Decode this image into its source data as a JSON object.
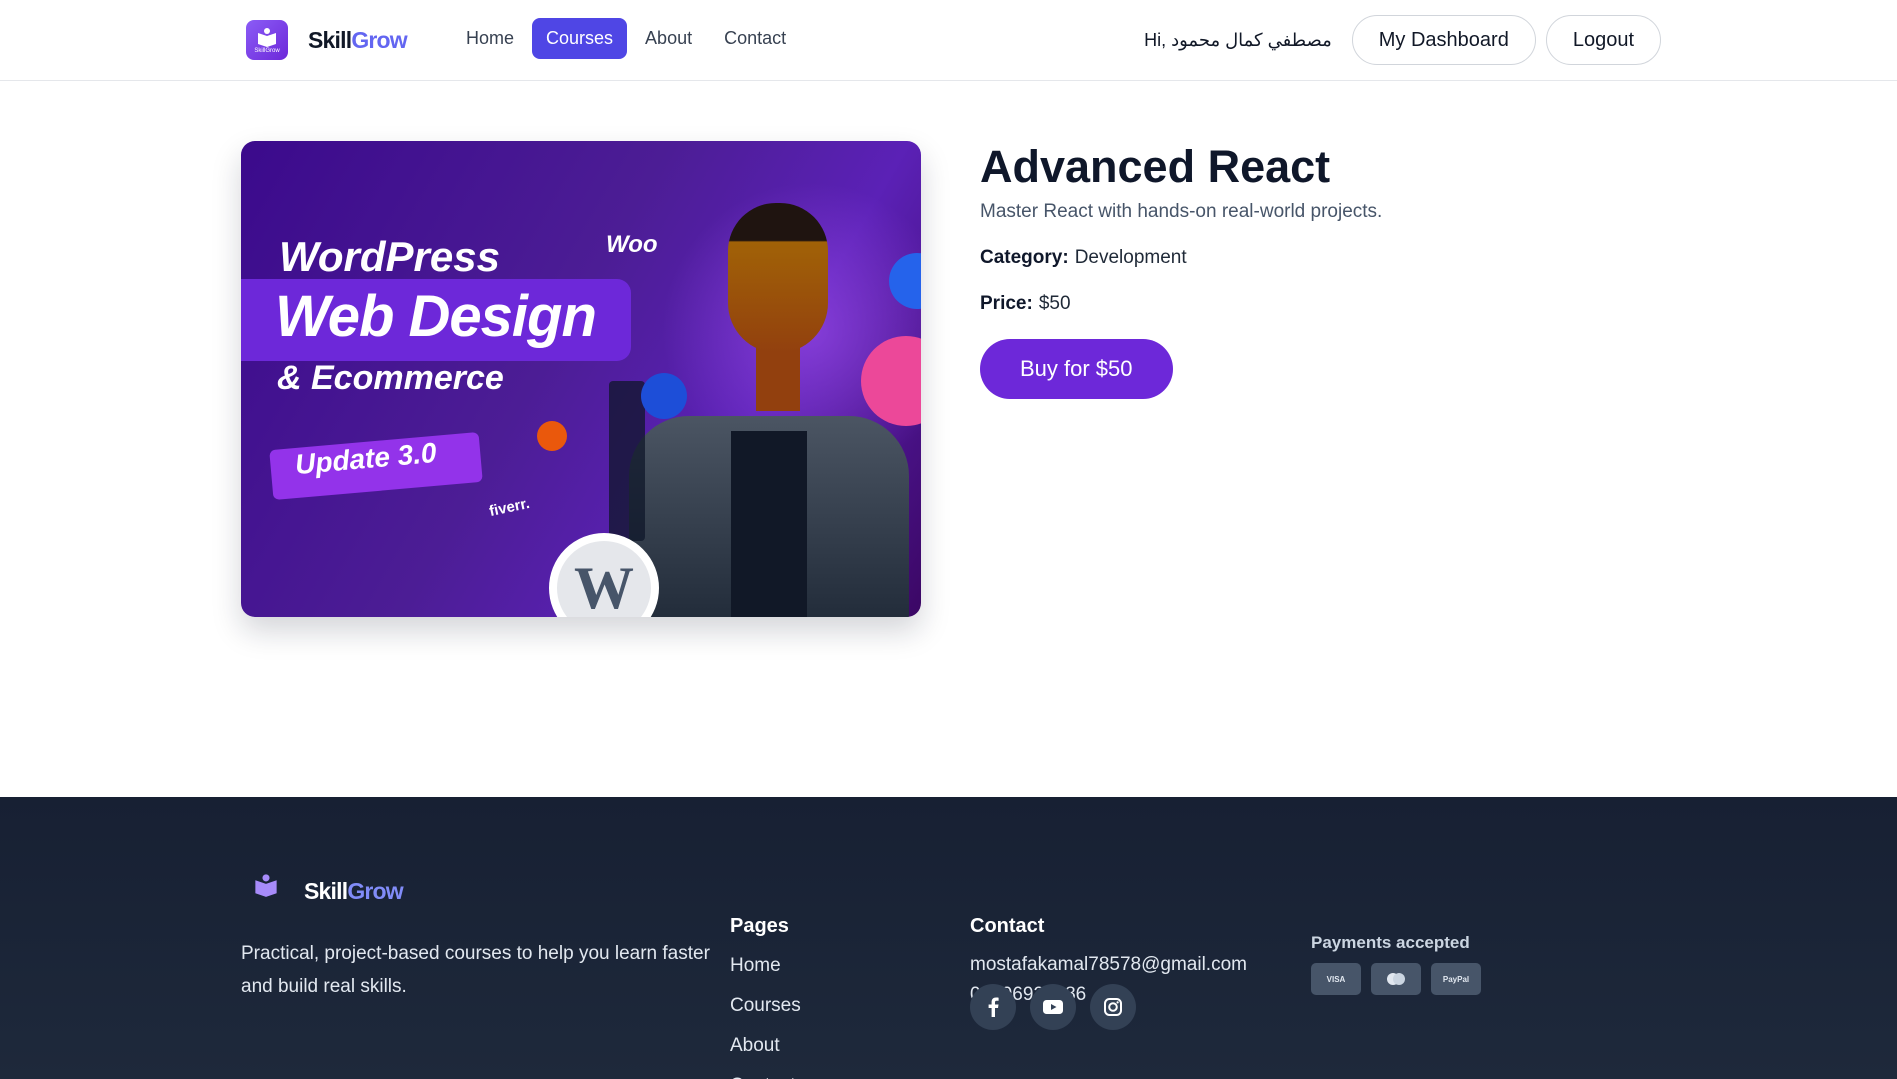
{
  "brand": {
    "name_part1": "Skill",
    "name_part2": "Grow",
    "badge_text": "SkillGrow"
  },
  "nav": {
    "items": [
      {
        "label": "Home",
        "active": false
      },
      {
        "label": "Courses",
        "active": true
      },
      {
        "label": "About",
        "active": false
      },
      {
        "label": "Contact",
        "active": false
      }
    ]
  },
  "user": {
    "greeting": "Hi, مصطفي كمال محمود",
    "dashboard_label": "My Dashboard",
    "logout_label": "Logout"
  },
  "course": {
    "title": "Advanced React",
    "description": "Master React with hands-on real-world projects.",
    "category_label": "Category:",
    "category": "Development",
    "price_label": "Price:",
    "price": "$50",
    "buy_label": "Buy for $50",
    "thumbnail": {
      "line1": "WordPress",
      "line2": "Web Design",
      "line3": "& Ecommerce",
      "tag": "Update 3.0",
      "woo": "Woo",
      "fiverr": "fiverr.",
      "wp_mark": "W"
    }
  },
  "footer": {
    "tagline": "Practical, project-based courses to help you learn faster and build real skills.",
    "pages_title": "Pages",
    "pages": [
      "Home",
      "Courses",
      "About",
      "Contact"
    ],
    "contact_title": "Contact",
    "email": "mostafakamal78578@gmail.com",
    "phone": "01096926586",
    "socials": [
      "facebook-icon",
      "youtube-icon",
      "instagram-icon"
    ],
    "payments_title": "Payments accepted",
    "payment_methods": [
      "VISA",
      "MC",
      "PayPal"
    ]
  },
  "colors": {
    "primary": "#4f46e5",
    "accent": "#6d28d9",
    "footer_bg": "#1e293b"
  }
}
